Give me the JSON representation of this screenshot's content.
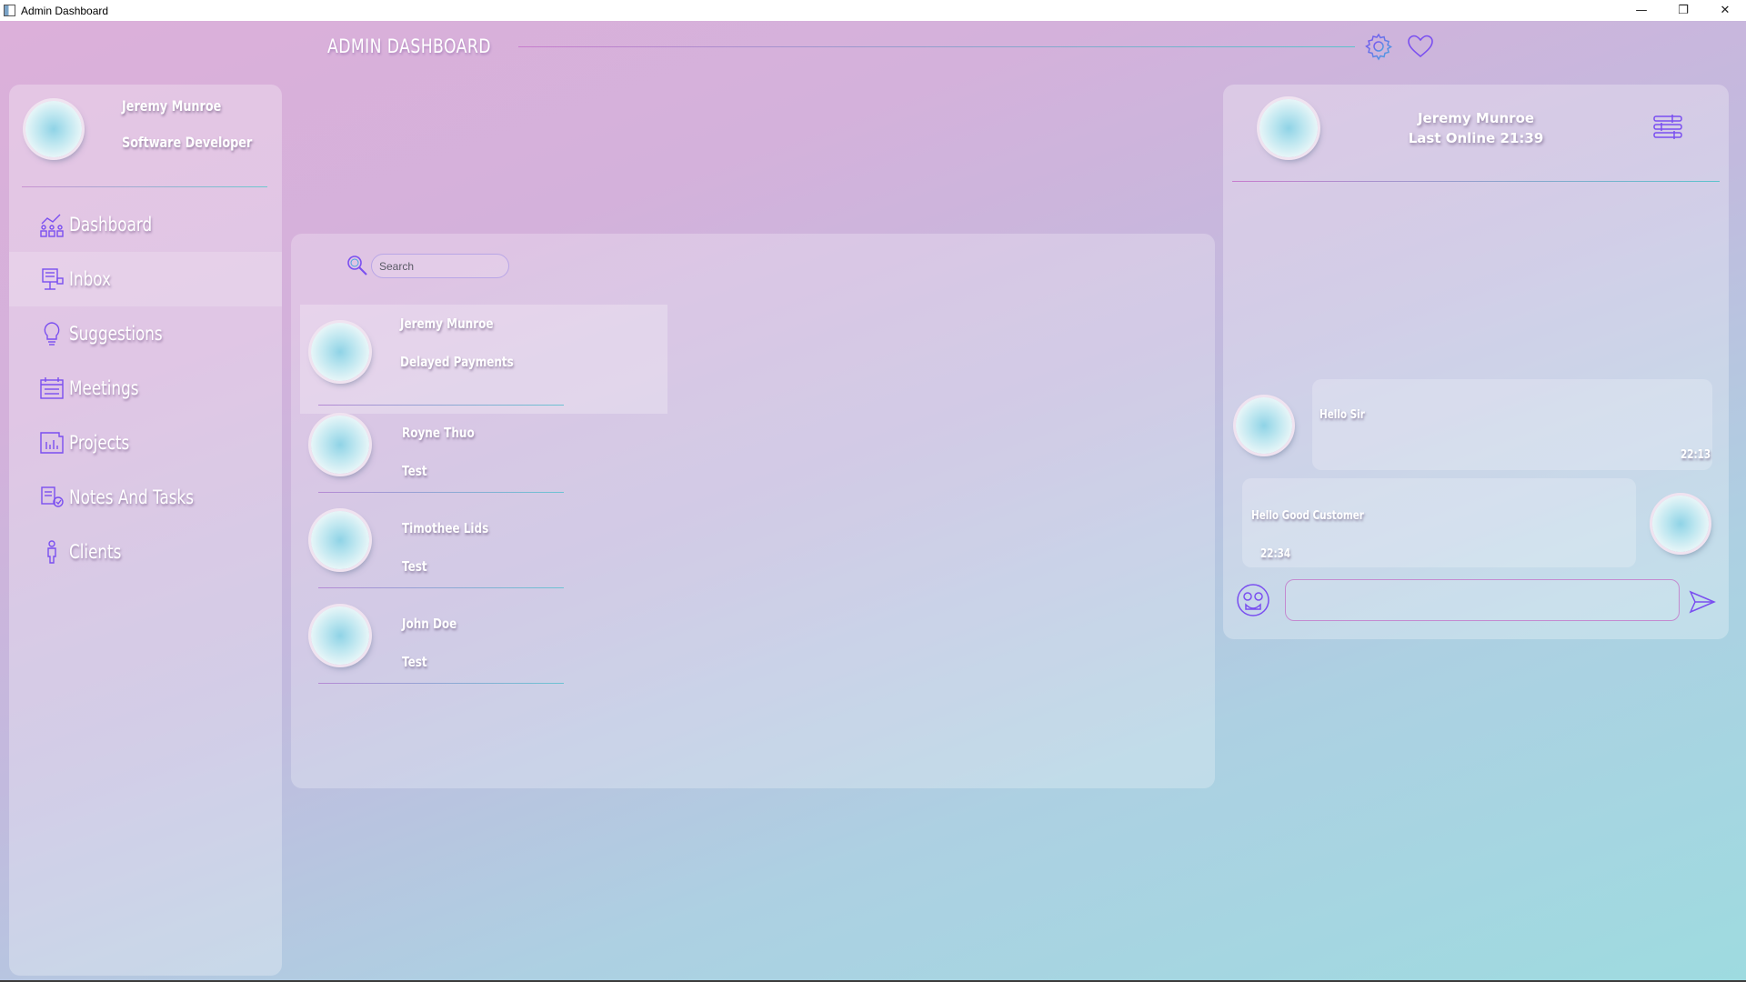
{
  "window": {
    "title": "Admin Dashboard",
    "minimize": "—",
    "maximize": "❐",
    "close": "✕"
  },
  "header": {
    "title": "ADMIN DASHBOARD",
    "settings_icon": "gear-icon",
    "favorite_icon": "heart-icon"
  },
  "profile": {
    "name": "Jeremy Munroe",
    "role": "Software Developer"
  },
  "nav": {
    "items": [
      {
        "label": "Dashboard",
        "icon": "chart-people-icon"
      },
      {
        "label": "Inbox",
        "icon": "inbox-icon"
      },
      {
        "label": "Suggestions",
        "icon": "lightbulb-icon"
      },
      {
        "label": "Meetings",
        "icon": "calendar-icon"
      },
      {
        "label": "Projects",
        "icon": "blueprint-icon"
      },
      {
        "label": "Notes And Tasks",
        "icon": "notes-icon"
      },
      {
        "label": "Clients",
        "icon": "person-icon"
      }
    ],
    "active": "Inbox"
  },
  "inbox": {
    "search_placeholder": "Search",
    "messages": [
      {
        "name": "Jeremy Munroe",
        "subject": "Delayed Payments",
        "selected": true
      },
      {
        "name": "Royne Thuo",
        "subject": "Test",
        "selected": false
      },
      {
        "name": "Timothee Lids",
        "subject": "Test",
        "selected": false
      },
      {
        "name": "John Doe",
        "subject": "Test",
        "selected": false
      }
    ]
  },
  "chat": {
    "contact_name": "Jeremy Munroe",
    "status": "Last Online 21:39",
    "messages": [
      {
        "text": "Hello Sir",
        "time": "22:13",
        "direction": "incoming"
      },
      {
        "text": "Hello Good Customer",
        "time": "22:34",
        "direction": "outgoing"
      }
    ],
    "input_value": "",
    "menu_icon": "sliders-icon",
    "emoji_icon": "emoji-face-icon",
    "send_icon": "send-icon"
  },
  "colors": {
    "accent_purple": "#8a5cf0",
    "accent_pink": "#c77ccd",
    "accent_cyan": "#5cc3cc"
  }
}
